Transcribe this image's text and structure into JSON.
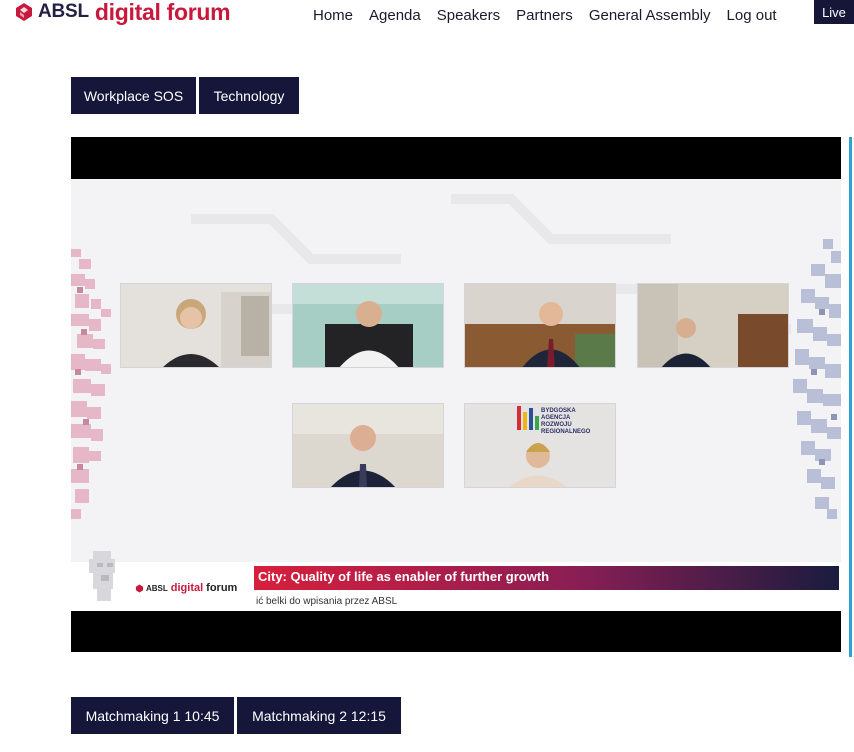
{
  "header": {
    "logo_absl": "ABSL",
    "logo_forum": "digital forum",
    "nav": [
      "Home",
      "Agenda",
      "Speakers",
      "Partners",
      "General Assembly",
      "Log out"
    ],
    "live_label": "Live"
  },
  "tags": {
    "top": [
      "Workplace SOS",
      "Technology"
    ],
    "bottom": [
      "Matchmaking 1 10:45",
      "Matchmaking 2 12:15"
    ]
  },
  "video": {
    "banner_title": "City: Quality of life as enabler of further growth",
    "subtitle": "ić belki do wpisania przez ABSL",
    "mini_logo_absl": "ABSL",
    "mini_logo_digital": "digital",
    "mini_logo_forum": "forum",
    "agency_lines": [
      "BYDGOSKA",
      "AGENCJA",
      "ROZWOJU",
      "REGIONALNEGO"
    ]
  },
  "colors": {
    "brand_red": "#c8193c",
    "navy": "#15163a",
    "scroll_accent": "#2f9fd6"
  }
}
